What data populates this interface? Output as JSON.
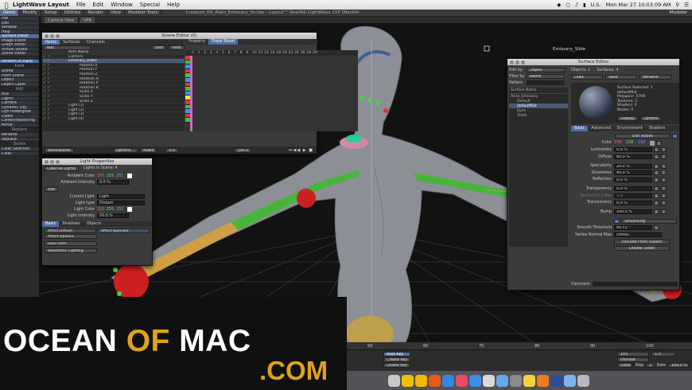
{
  "menubar": {
    "app": "LightWave Layout",
    "items": [
      "File",
      "Edit",
      "Window",
      "Special",
      "Help"
    ],
    "flag": "U.S.",
    "datetime": "Mon Mar 27  10:03:09 AM"
  },
  "lwbar": {
    "tabs": [
      "Items",
      "Modify",
      "Setup",
      "Utilities",
      "Render",
      "View",
      "Modeler Tools"
    ],
    "window_title": "Creature_Kit_Alien_Emissary_fin.lws – Layout™ NewTek LightWave 15P (Mac64)",
    "modeler": "Modeler",
    "camera_view": "Camera View",
    "vpr": "VPR"
  },
  "lefttb": {
    "groups": [
      {
        "header": "",
        "items": [
          "File",
          "Edit",
          "Window",
          "Help",
          "Surface Editor",
          "Image Editor",
          "Graph Editor",
          "Virtual Studio",
          "Scene Editor"
        ]
      },
      {
        "header": "",
        "items": [
          "Perform in Place"
        ]
      },
      {
        "header": "Load",
        "items": [
          "Scene",
          "From Scene",
          "Object",
          "Object Layer"
        ]
      },
      {
        "header": "Add",
        "items": [
          "Null",
          "Lights",
          "Camera",
          "Dynamic Obj",
          "Dyn Powerglow",
          "Distro",
          "Cloner/Instancing",
          "Mirror"
        ]
      },
      {
        "header": "Replace",
        "items": [
          "Rename",
          "Replace"
        ]
      },
      {
        "header": "Delete",
        "items": [
          "Clear Selected",
          "Clear"
        ]
      }
    ]
  },
  "scene_editor": {
    "title": "Scene Editor (0)",
    "tabs": [
      "Items",
      "Surfaces",
      "Channels"
    ],
    "right_tabs": [
      "Property",
      "Dope Sheet"
    ],
    "filter_label": "Text",
    "sets": "Sets",
    "filter": "Filter",
    "item_name_header": "Item Name",
    "rows": [
      "Camera",
      "Emissary_Rides",
      "Position.X",
      "Position.Y",
      "Position.Z",
      "Rotation.H",
      "Rotation.P",
      "Rotation.B",
      "Scale.X",
      "Scale.Y",
      "Scale.Z",
      "Light (1)",
      "Light (2)",
      "Light (3)",
      "Light (4)"
    ],
    "frames": [
      "0",
      "1",
      "2",
      "3",
      "4",
      "5",
      "6",
      "7",
      "8",
      "9",
      "10",
      "12",
      "14",
      "16",
      "18",
      "20",
      "22",
      "24",
      "26",
      "28",
      "29"
    ],
    "bottom": {
      "workspace": "Workspaces",
      "options": "Options...",
      "audio": "Audio",
      "start": "0.0",
      "end": "100.0"
    }
  },
  "light_props": {
    "title": "Light Properties",
    "clear_all": "Clear All Lights",
    "lights_in_scene": "Lights in Scene: 4",
    "ambient_color_label": "Ambient Color",
    "ambient_color": [
      "255",
      "255",
      "255"
    ],
    "ambient_intensity_label": "Ambient Intensity",
    "ambient_intensity": "0.0 %",
    "edit_label": "Edit",
    "current_light_label": "Current Light",
    "current_light": "Light",
    "light_type_label": "Light type",
    "light_type": "Distant",
    "light_color_label": "Light Color",
    "light_color": [
      "255",
      "255",
      "255"
    ],
    "light_intensity_label": "Light Intensity",
    "light_intensity": "50.0 %",
    "tabs": [
      "Basic",
      "Shadows",
      "Objects"
    ],
    "buttons_left": [
      "Affect Diffuse",
      "Affect OpenGL",
      "Lens Flare",
      "Volumetric Lighting"
    ],
    "buttons_right": [
      "Affect Specular"
    ]
  },
  "surface_editor": {
    "title": "Surface Editor",
    "edit_by_label": "Edit by",
    "edit_by": "Object",
    "filter_label": "Filter by",
    "filter": "Name",
    "pattern_label": "Pattern",
    "objects": "Objects: 1",
    "surfaces": "Surfaces: 4",
    "load": "Load",
    "save": "Save",
    "rename": "Rename",
    "surface_name_header": "Surface Name",
    "surfaces_list": [
      "Alien_Emissary",
      "Default",
      "defaultMat",
      "Eyes",
      "Teeth"
    ],
    "info": [
      "Surface Selected: 1",
      "defaultMat",
      "Polygons: 5768",
      "Textures: 2",
      "Shaders: 0",
      "Nodes: 0"
    ],
    "display": "Display",
    "options": "Options",
    "tabs": [
      "Basic",
      "Advanced",
      "Environment",
      "Shaders"
    ],
    "edit_nodes": "Edit Nodes",
    "color_label": "Color",
    "color": [
      "158",
      "158",
      "158"
    ],
    "luminosity_label": "Luminosity",
    "luminosity": "0.0 %",
    "diffuse_label": "Diffuse",
    "diffuse": "80.0 %",
    "specularity_label": "Specularity",
    "specularity": "20.0 %",
    "glossiness_label": "Glossiness",
    "glossiness": "40.0 %",
    "reflection_label": "Reflection",
    "reflection": "0.0 %",
    "transparency_label": "Transparency",
    "transparency": "0.0 %",
    "refraction_label": "Refraction Index",
    "refraction": "1.0",
    "translucency_label": "Translucency",
    "translucency": "0.0 %",
    "bump_label": "Bump",
    "bump": "100.0 %",
    "smoothing": "Smoothing",
    "smooth_thresh_label": "Smooth Threshold",
    "smooth_thresh": "89.53 °",
    "vertex_map_label": "Vertex Normal Map",
    "vertex_map": "(none)",
    "exclude_vmap": "Exclude From VStack",
    "double_sided": "Double Sided",
    "comment_label": "Comment"
  },
  "viewport": {
    "label": "Emissary_Slide"
  },
  "timeline": {
    "ticks": [
      "50",
      "60",
      "70",
      "80",
      "90",
      "100"
    ],
    "auto_key": "Auto Key",
    "create_key": "Create Key",
    "delete_key": "Delete Key",
    "preview": "Preview",
    "undo": "Undo",
    "step_label": "Step",
    "step": "1",
    "rate_label": "Rate",
    "rate": "100.0 %",
    "frame_end": "100",
    "frame_step": "1.0"
  },
  "watermark": {
    "ocean": "OCEAN ",
    "of": "OF",
    "mac": " MAC",
    "com": ".COM"
  },
  "colors": {
    "accent": "#4f6fa8",
    "watermark_orange": "#e0a21a"
  }
}
